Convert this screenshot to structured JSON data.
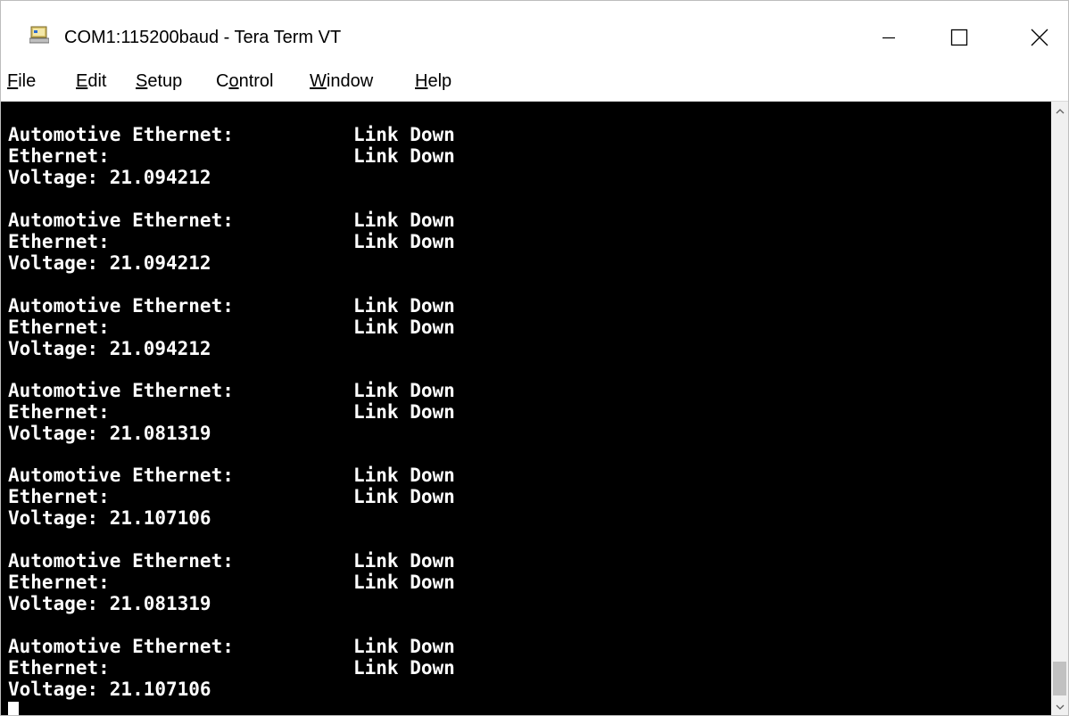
{
  "window": {
    "title": "COM1:115200baud - Tera Term VT",
    "icon": "tera-term-app-icon"
  },
  "controls": {
    "minimize": "minimize-icon",
    "maximize": "maximize-icon",
    "close": "close-icon"
  },
  "menu": {
    "file": {
      "mnemonic": "F",
      "rest": "ile"
    },
    "edit": {
      "mnemonic": "E",
      "rest": "dit"
    },
    "setup": {
      "mnemonic": "S",
      "rest": "etup"
    },
    "control": {
      "pre": "C",
      "mnemonic": "o",
      "rest": "ntrol"
    },
    "window": {
      "mnemonic": "W",
      "rest": "indow"
    },
    "help": {
      "mnemonic": "H",
      "rest": "elp"
    }
  },
  "terminal": {
    "colors": {
      "background": "#000000",
      "foreground": "#ffffff"
    },
    "blocks": [
      {
        "auto_label": "Automotive Ethernet:",
        "auto_status": "Link Down",
        "eth_label": "Ethernet:",
        "eth_status": "Link Down",
        "voltage_line": "Voltage: 21.094212"
      },
      {
        "auto_label": "Automotive Ethernet:",
        "auto_status": "Link Down",
        "eth_label": "Ethernet:",
        "eth_status": "Link Down",
        "voltage_line": "Voltage: 21.094212"
      },
      {
        "auto_label": "Automotive Ethernet:",
        "auto_status": "Link Down",
        "eth_label": "Ethernet:",
        "eth_status": "Link Down",
        "voltage_line": "Voltage: 21.094212"
      },
      {
        "auto_label": "Automotive Ethernet:",
        "auto_status": "Link Down",
        "eth_label": "Ethernet:",
        "eth_status": "Link Down",
        "voltage_line": "Voltage: 21.081319"
      },
      {
        "auto_label": "Automotive Ethernet:",
        "auto_status": "Link Down",
        "eth_label": "Ethernet:",
        "eth_status": "Link Down",
        "voltage_line": "Voltage: 21.107106"
      },
      {
        "auto_label": "Automotive Ethernet:",
        "auto_status": "Link Down",
        "eth_label": "Ethernet:",
        "eth_status": "Link Down",
        "voltage_line": "Voltage: 21.081319"
      },
      {
        "auto_label": "Automotive Ethernet:",
        "auto_status": "Link Down",
        "eth_label": "Ethernet:",
        "eth_status": "Link Down",
        "voltage_line": "Voltage: 21.107106"
      }
    ]
  }
}
